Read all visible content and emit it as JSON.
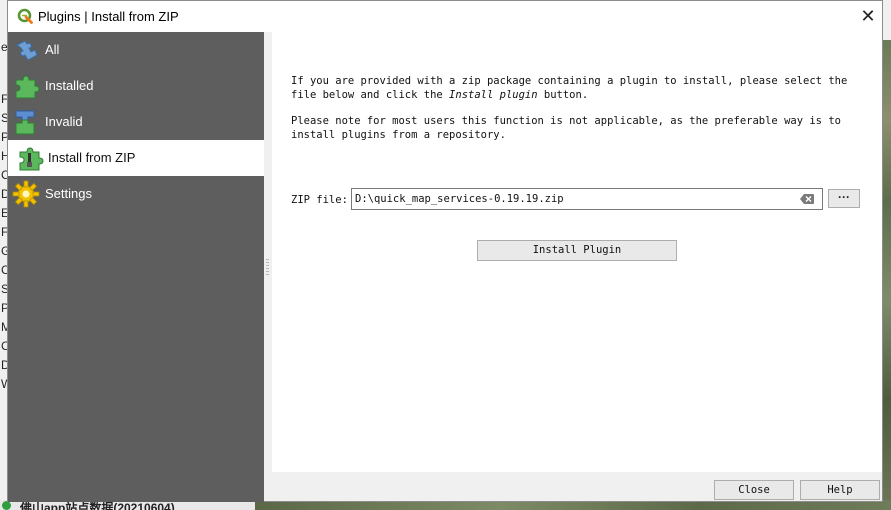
{
  "window": {
    "title": "Plugins | Install from ZIP"
  },
  "sidebar": {
    "items": [
      {
        "label": "All",
        "icon": "puzzle-blue-icon"
      },
      {
        "label": "Installed",
        "icon": "puzzle-green-icon"
      },
      {
        "label": "Invalid",
        "icon": "puzzle-blue-green-icon"
      },
      {
        "label": "Install from ZIP",
        "icon": "puzzle-zip-icon",
        "active": true
      },
      {
        "label": "Settings",
        "icon": "gear-icon"
      }
    ]
  },
  "panel": {
    "para1_a": "If you are provided with a zip package containing a plugin to install, please select the file below and click the ",
    "para1_em": "Install plugin",
    "para1_b": " button.",
    "para2": "Please note for most users this function is not applicable, as the preferable way is to install plugins from a repository.",
    "zip_label": "ZIP file:",
    "zip_value": "D:\\quick_map_services-0.19.19.zip",
    "browse_label": "···",
    "install_label": "Install Plugin"
  },
  "footer": {
    "close_label": "Close",
    "help_label": "Help"
  },
  "background": {
    "left_letters": [
      "er",
      "F",
      "S",
      "P",
      "H",
      "C",
      "D",
      "E",
      "F",
      "G",
      "C",
      "S",
      "P",
      "M",
      "C",
      "D",
      "W"
    ],
    "bottom_text": "佛山app站点数据(20210604)"
  },
  "colors": {
    "sidebar": "#5e5e5e",
    "active_item": "#ffffff",
    "dialog_bg": "#f0f0f0"
  }
}
